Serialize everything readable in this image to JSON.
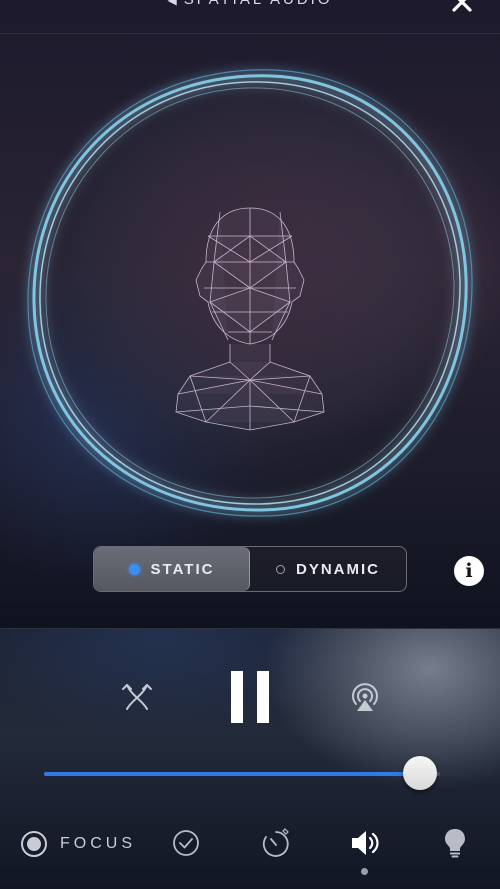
{
  "header": {
    "title": "SPATIAL AUDIO"
  },
  "mode": {
    "options": [
      {
        "label": "STATIC",
        "selected": true
      },
      {
        "label": "DYNAMIC",
        "selected": false
      }
    ]
  },
  "info": {
    "glyph": "i"
  },
  "player": {
    "state": "playing",
    "volume": 0.95
  },
  "bottom_nav": {
    "focus_label": "FOCUS",
    "items": [
      "focus-icon",
      "check-icon",
      "timer-icon",
      "speaker-icon",
      "lightbulb-icon"
    ],
    "active": "speaker-icon"
  },
  "colors": {
    "accent": "#3d8ef3",
    "orb_glow": "#8fdcf5"
  }
}
